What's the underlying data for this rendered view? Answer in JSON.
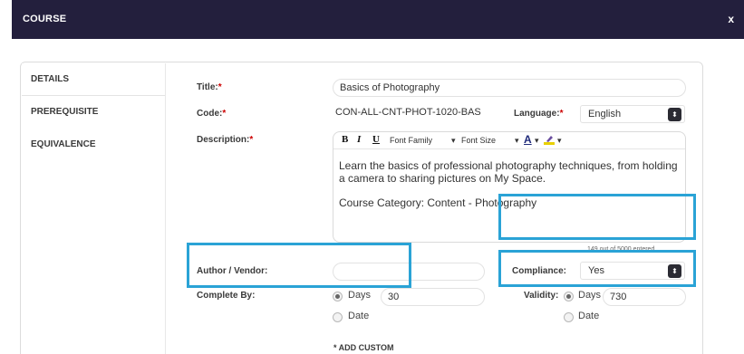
{
  "dialog": {
    "title": "COURSE",
    "close_label": "x"
  },
  "tabs": [
    {
      "label": "DETAILS",
      "active": true
    },
    {
      "label": "PREREQUISITE",
      "active": false
    },
    {
      "label": "EQUIVALENCE",
      "active": false
    }
  ],
  "form": {
    "title_label": "Title:",
    "title_value": "Basics of Photography",
    "code_label": "Code:",
    "code_value": "CON-ALL-CNT-PHOT-1020-BAS",
    "language_label": "Language:",
    "language_value": "English",
    "description_label": "Description:",
    "required_mark": "*",
    "toolbar": {
      "bold": "B",
      "italic": "I",
      "underline": "U",
      "font_family": "Font Family",
      "font_size": "Font Size",
      "font_color": "A",
      "dropdown_arrow": "▾"
    },
    "description_text_1": "Learn the basics of professional photography techniques, from holding a camera to sharing pictures on My Space.",
    "description_text_2": "Course Category: Content - Photography",
    "char_counter": "149 out of 5000 entered",
    "author_label": "Author / Vendor:",
    "author_value": "",
    "compliance_label": "Compliance:",
    "compliance_value": "Yes",
    "complete_by_label": "Complete By:",
    "complete_by_days_label": "Days",
    "complete_by_days_value": "30",
    "complete_by_date_label": "Date",
    "validity_label": "Validity:",
    "validity_days_label": "Days",
    "validity_days_value": "730",
    "validity_date_label": "Date",
    "add_custom_label": "* ADD CUSTOM"
  },
  "colors": {
    "titlebar": "#231f3d",
    "highlight": "#2aa3d6",
    "required": "#cc0000"
  },
  "icons": {
    "close": "close-icon",
    "dropdown": "chevron-updown-icon",
    "highlighter": "highlighter-icon"
  }
}
